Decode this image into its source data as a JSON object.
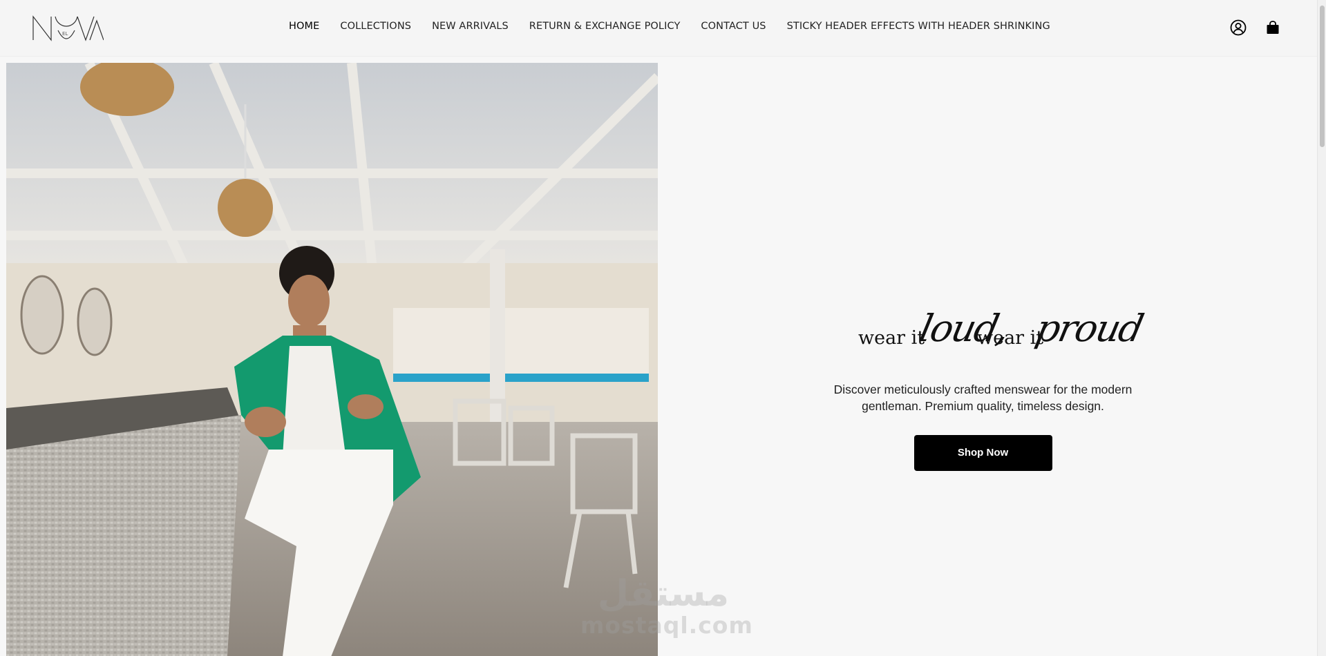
{
  "header": {
    "logo": {
      "main": "NOVA",
      "small": "EL"
    },
    "nav": [
      {
        "label": "HOME",
        "active": true
      },
      {
        "label": "COLLECTIONS"
      },
      {
        "label": "NEW ARRIVALS"
      },
      {
        "label": "RETURN & EXCHANGE POLICY"
      },
      {
        "label": "CONTACT US"
      },
      {
        "label": "STICKY HEADER EFFECTS WITH HEADER SHRINKING"
      }
    ],
    "icons": {
      "account": "account-icon",
      "cart": "shopping-bag-icon"
    }
  },
  "hero": {
    "tagline_part1": "wear it",
    "tagline_script1": "loud,",
    "tagline_part2": "wear it",
    "tagline_script2": "proud",
    "description": "Discover meticulously crafted menswear for the modern gentleman. Premium quality, timeless design.",
    "cta_label": "Shop Now"
  },
  "watermark": {
    "arabic": "مستقل",
    "latin": "mostaql.com"
  },
  "colors": {
    "background": "#f7f7f7",
    "button": "#000000",
    "shirt": "#139a6e"
  }
}
